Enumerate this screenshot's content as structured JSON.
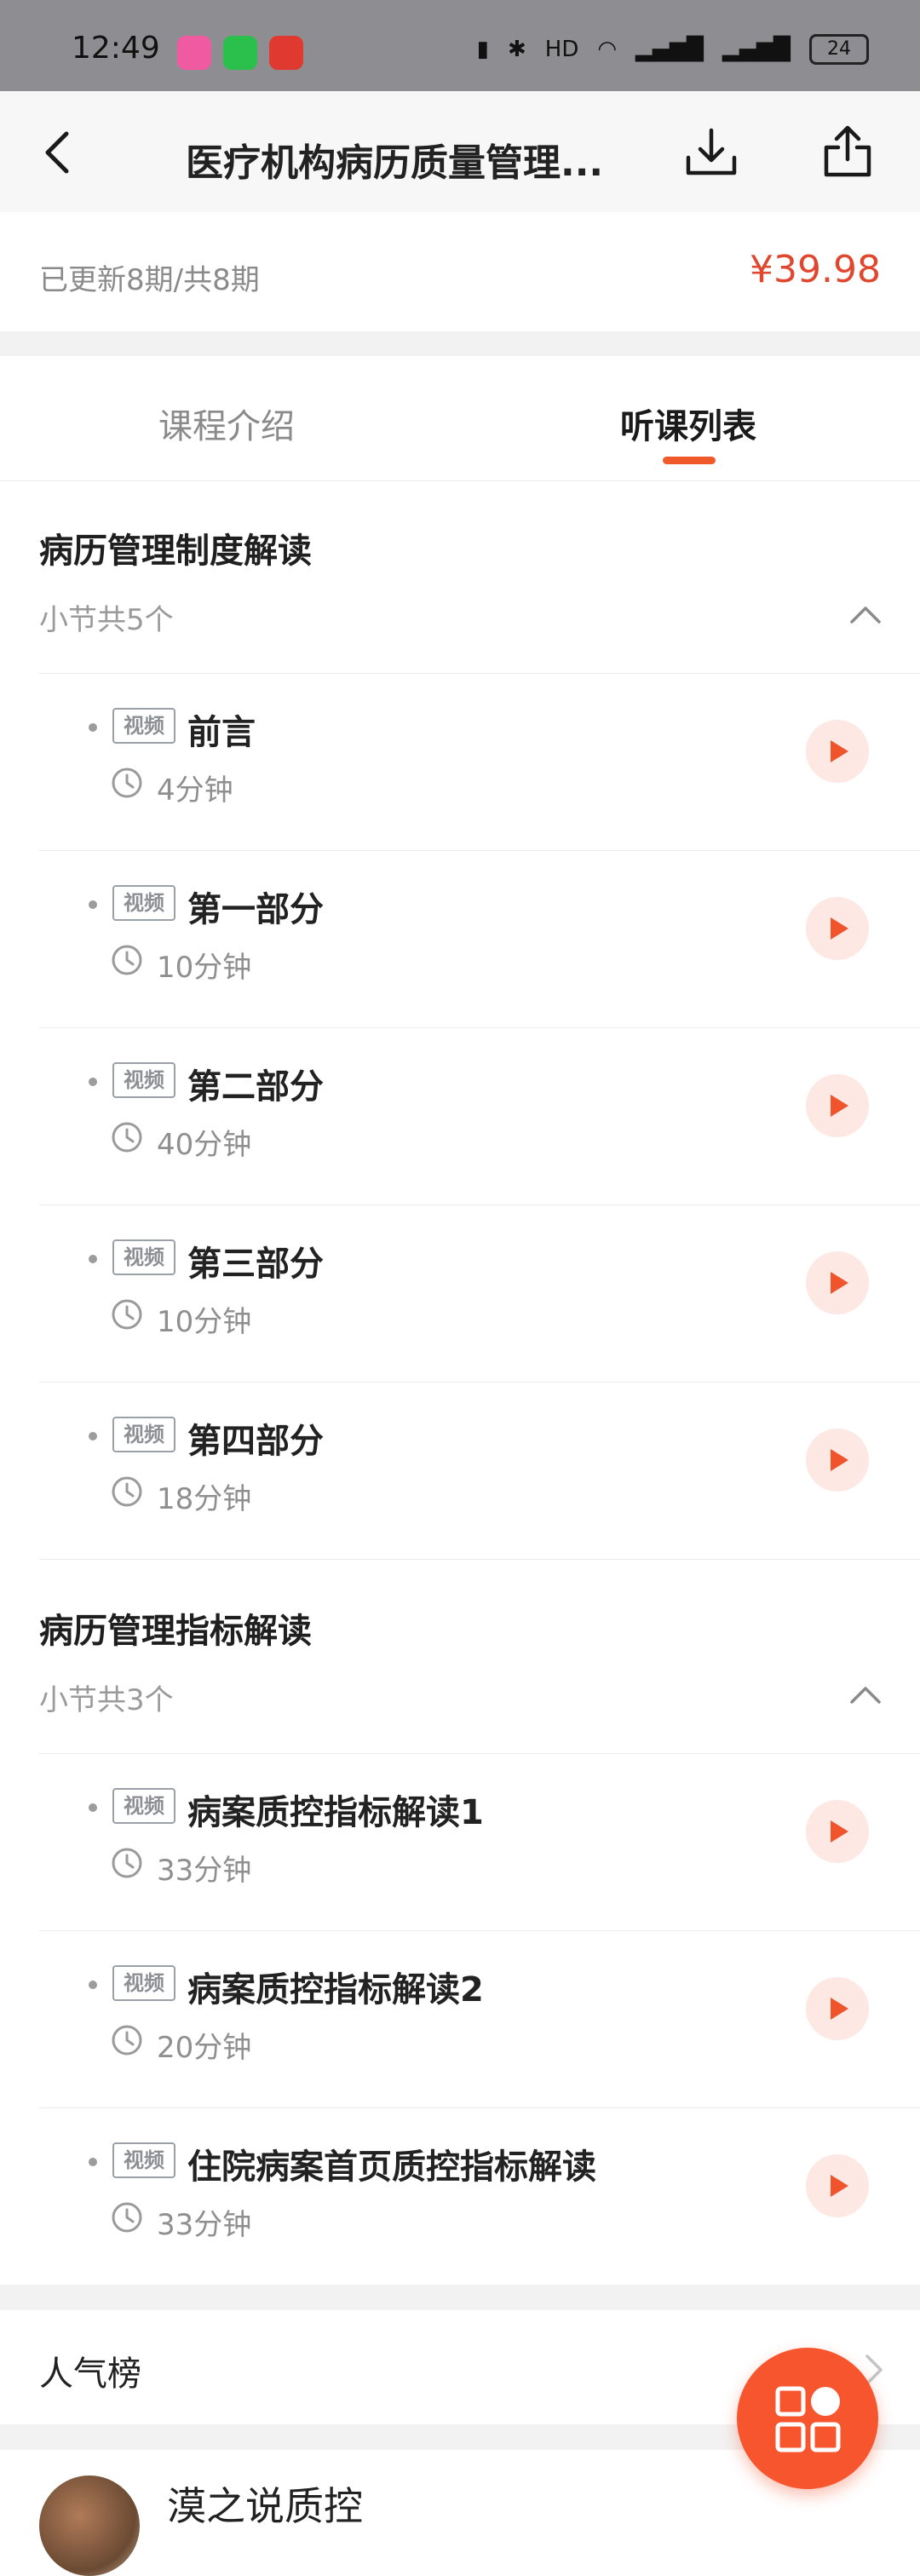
{
  "status_bar": {
    "time": "12:49",
    "battery": "24"
  },
  "nav": {
    "title": "医疗机构病历质量管理..."
  },
  "info": {
    "progress": "已更新8期/共8期",
    "price": "¥39.98"
  },
  "tabs": [
    {
      "label": "课程介绍",
      "active": false
    },
    {
      "label": "听课列表",
      "active": true
    }
  ],
  "sections": [
    {
      "title": "病历管理制度解读",
      "count": "小节共5个",
      "lessons": [
        {
          "tag": "视频",
          "title": "前言",
          "duration": "4分钟"
        },
        {
          "tag": "视频",
          "title": "第一部分",
          "duration": "10分钟"
        },
        {
          "tag": "视频",
          "title": "第二部分",
          "duration": "40分钟"
        },
        {
          "tag": "视频",
          "title": "第三部分",
          "duration": "10分钟"
        },
        {
          "tag": "视频",
          "title": "第四部分",
          "duration": "18分钟"
        }
      ]
    },
    {
      "title": "病历管理指标解读",
      "count": "小节共3个",
      "lessons": [
        {
          "tag": "视频",
          "title": "病案质控指标解读1",
          "duration": "33分钟"
        },
        {
          "tag": "视频",
          "title": "病案质控指标解读2",
          "duration": "20分钟"
        },
        {
          "tag": "视频",
          "title": "住院病案首页质控指标解读",
          "duration": "33分钟"
        }
      ]
    }
  ],
  "popular": {
    "label": "人气榜"
  },
  "profile": {
    "name": "漠之说质控"
  },
  "colors": {
    "accent": "#f05a2b",
    "price": "#e0472f",
    "fab": "#f6552e"
  }
}
